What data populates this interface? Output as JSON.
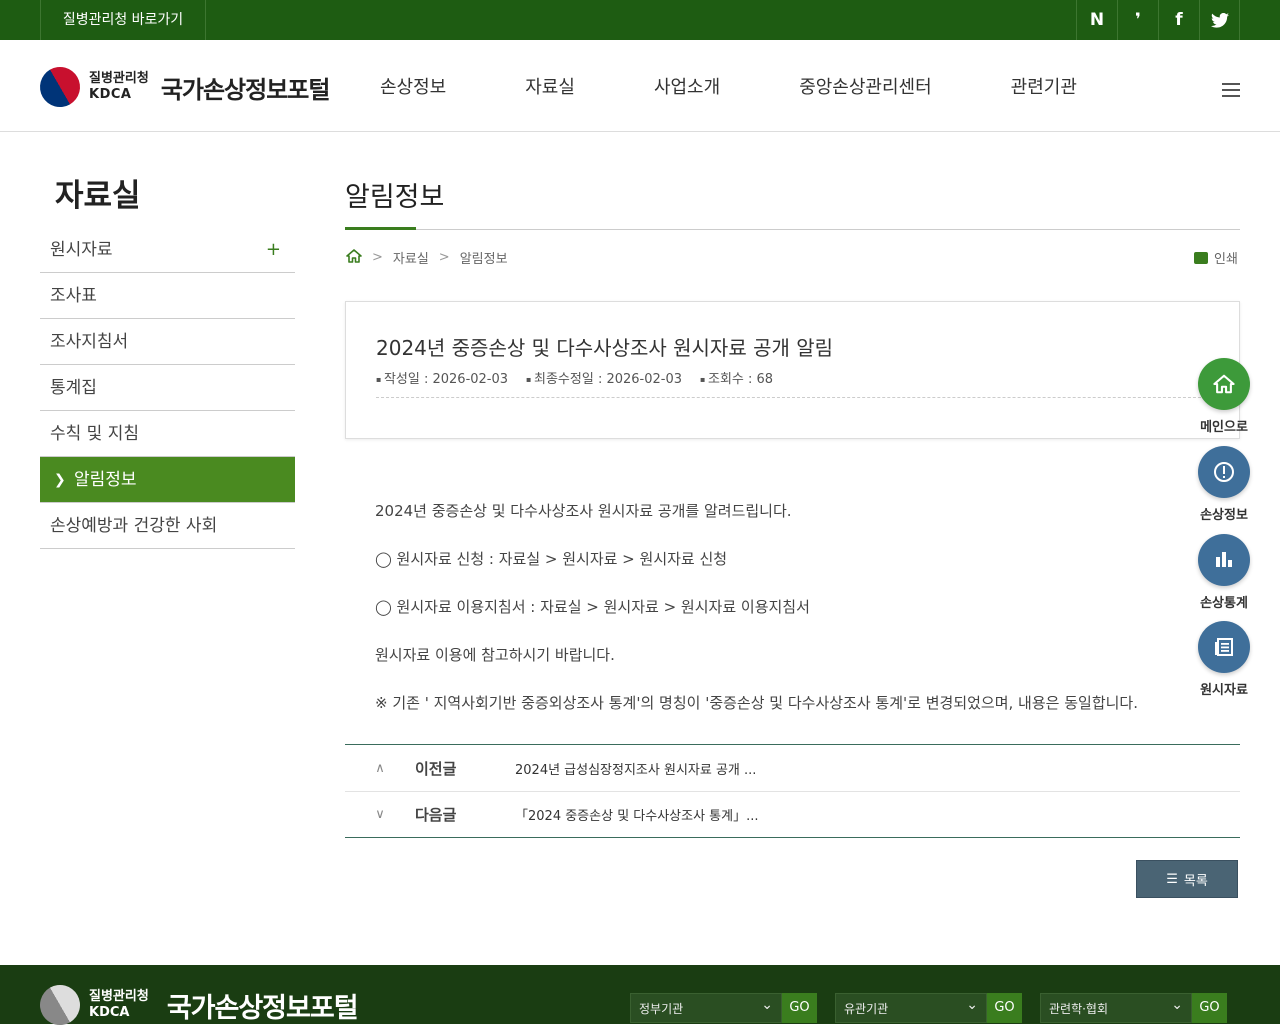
{
  "topbar": {
    "shortcut": "질병관리청 바로가기",
    "sns": [
      "N",
      "❜",
      "f",
      "🐦"
    ]
  },
  "header": {
    "org_name": "질병관리청",
    "org_abbr": "KDCA",
    "portal_name": "국가손상정보포털",
    "nav": [
      "손상정보",
      "자료실",
      "사업소개",
      "중앙손상관리센터",
      "관련기관"
    ]
  },
  "sidebar": {
    "title": "자료실",
    "items": [
      {
        "label": "원시자료",
        "expand": "+"
      },
      {
        "label": "조사표"
      },
      {
        "label": "조사지침서"
      },
      {
        "label": "통계집"
      },
      {
        "label": "수칙 및 지침"
      },
      {
        "label": "알림정보",
        "active": true
      },
      {
        "label": "손상예방과 건강한 사회"
      }
    ]
  },
  "main": {
    "page_title": "알림정보",
    "breadcrumb": [
      "자료실",
      "알림정보"
    ],
    "print_label": "인쇄",
    "post": {
      "title": "2024년 중증손상 및 다수사상조사 원시자료 공개 알림",
      "created": "작성일 : 2026-02-03",
      "modified": "최종수정일 : 2026-02-03",
      "views": "조회수 : 68",
      "body": [
        "2024년 중증손상 및 다수사상조사 원시자료 공개를 알려드립니다.",
        "◯ 원시자료 신청 : 자료실 > 원시자료 > 원시자료 신청",
        "◯ 원시자료 이용지침서 : 자료실 > 원시자료 > 원시자료 이용지침서",
        "원시자료 이용에 참고하시기 바랍니다.",
        "※ 기존 ' 지역사회기반 중증외상조사 통계'의 명칭이 '중증손상 및 다수사상조사 통계'로 변경되었으며, 내용은 동일합니다."
      ]
    },
    "prev": {
      "label": "이전글",
      "title": "2024년 급성심장정지조사 원시자료 공개 ..."
    },
    "next": {
      "label": "다음글",
      "title": "「2024 중증손상 및 다수사상조사 통계」..."
    },
    "list_button": "목록"
  },
  "quick_menu": [
    {
      "label": "메인으로",
      "icon": "home-icon",
      "color": "#3d9a3a"
    },
    {
      "label": "손상정보",
      "icon": "alert-icon",
      "color": "#3f6f9a"
    },
    {
      "label": "손상통계",
      "icon": "chart-icon",
      "color": "#3f6f9a"
    },
    {
      "label": "원시자료",
      "icon": "document-icon",
      "color": "#3f6f9a"
    }
  ],
  "footer": {
    "org_name": "질병관리청",
    "org_abbr": "KDCA",
    "portal_name": "국가손상정보포털",
    "selects": [
      {
        "label": "정부기관",
        "go": "GO"
      },
      {
        "label": "유관기관",
        "go": "GO"
      },
      {
        "label": "관련학·협회",
        "go": "GO"
      }
    ]
  }
}
